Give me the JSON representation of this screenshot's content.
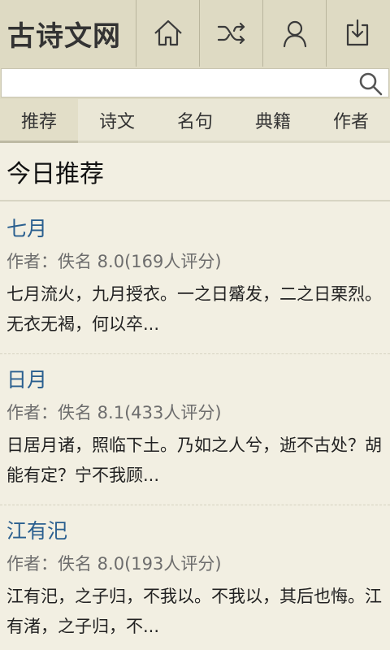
{
  "header": {
    "title": "古诗文网",
    "icons": [
      "home-icon",
      "shuffle-icon",
      "user-icon",
      "download-icon"
    ]
  },
  "search": {
    "value": "",
    "placeholder": ""
  },
  "tabs": [
    {
      "label": "推荐",
      "active": true
    },
    {
      "label": "诗文",
      "active": false
    },
    {
      "label": "名句",
      "active": false
    },
    {
      "label": "典籍",
      "active": false
    },
    {
      "label": "作者",
      "active": false
    }
  ],
  "section": {
    "title": "今日推荐"
  },
  "items": [
    {
      "title": "七月",
      "meta": "作者：佚名  8.0(169人评分)",
      "excerpt": "七月流火，九月授衣。一之日觱发，二之日栗烈。无衣无褐，何以卒..."
    },
    {
      "title": "日月",
      "meta": "作者：佚名  8.1(433人评分)",
      "excerpt": "日居月诸，照临下土。乃如之人兮，逝不古处？胡能有定？宁不我顾..."
    },
    {
      "title": "江有汜",
      "meta": "作者：佚名  8.0(193人评分)",
      "excerpt": "江有汜，之子归，不我以。不我以，其后也悔。江有渚，之子归，不..."
    }
  ],
  "colors": {
    "header_bg": "#dedac3",
    "page_bg": "#f2efe2",
    "title_link": "#2a5f8f"
  }
}
